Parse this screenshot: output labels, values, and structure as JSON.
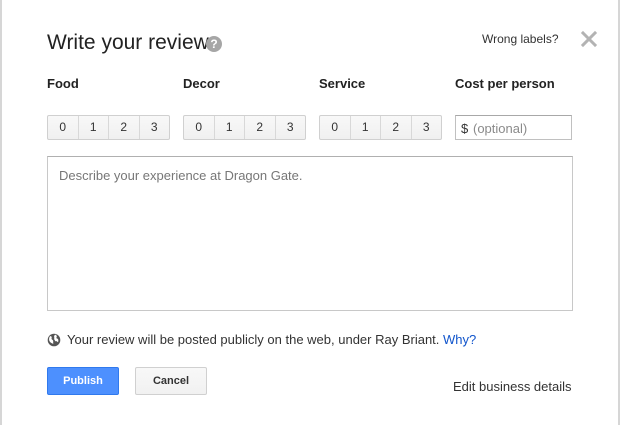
{
  "dialog": {
    "title": "Write your review",
    "help_icon": "question-circle-icon",
    "wrong_labels": "Wrong labels?",
    "close_icon": "close-x-icon"
  },
  "ratings": {
    "categories": [
      {
        "label": "Food",
        "options": [
          "0",
          "1",
          "2",
          "3"
        ]
      },
      {
        "label": "Decor",
        "options": [
          "0",
          "1",
          "2",
          "3"
        ]
      },
      {
        "label": "Service",
        "options": [
          "0",
          "1",
          "2",
          "3"
        ]
      }
    ],
    "cost": {
      "label": "Cost per person",
      "currency": "$",
      "placeholder": "(optional)"
    }
  },
  "review": {
    "placeholder": "Describe your experience at Dragon Gate."
  },
  "notice": {
    "icon": "globe-icon",
    "text": "Your review will be posted publicly on the web, under Ray Briant.",
    "link": "Why?"
  },
  "actions": {
    "publish": "Publish",
    "cancel": "Cancel",
    "edit_business": "Edit business details"
  },
  "colors": {
    "primary_button": "#4d90fe",
    "link": "#1155cc"
  }
}
